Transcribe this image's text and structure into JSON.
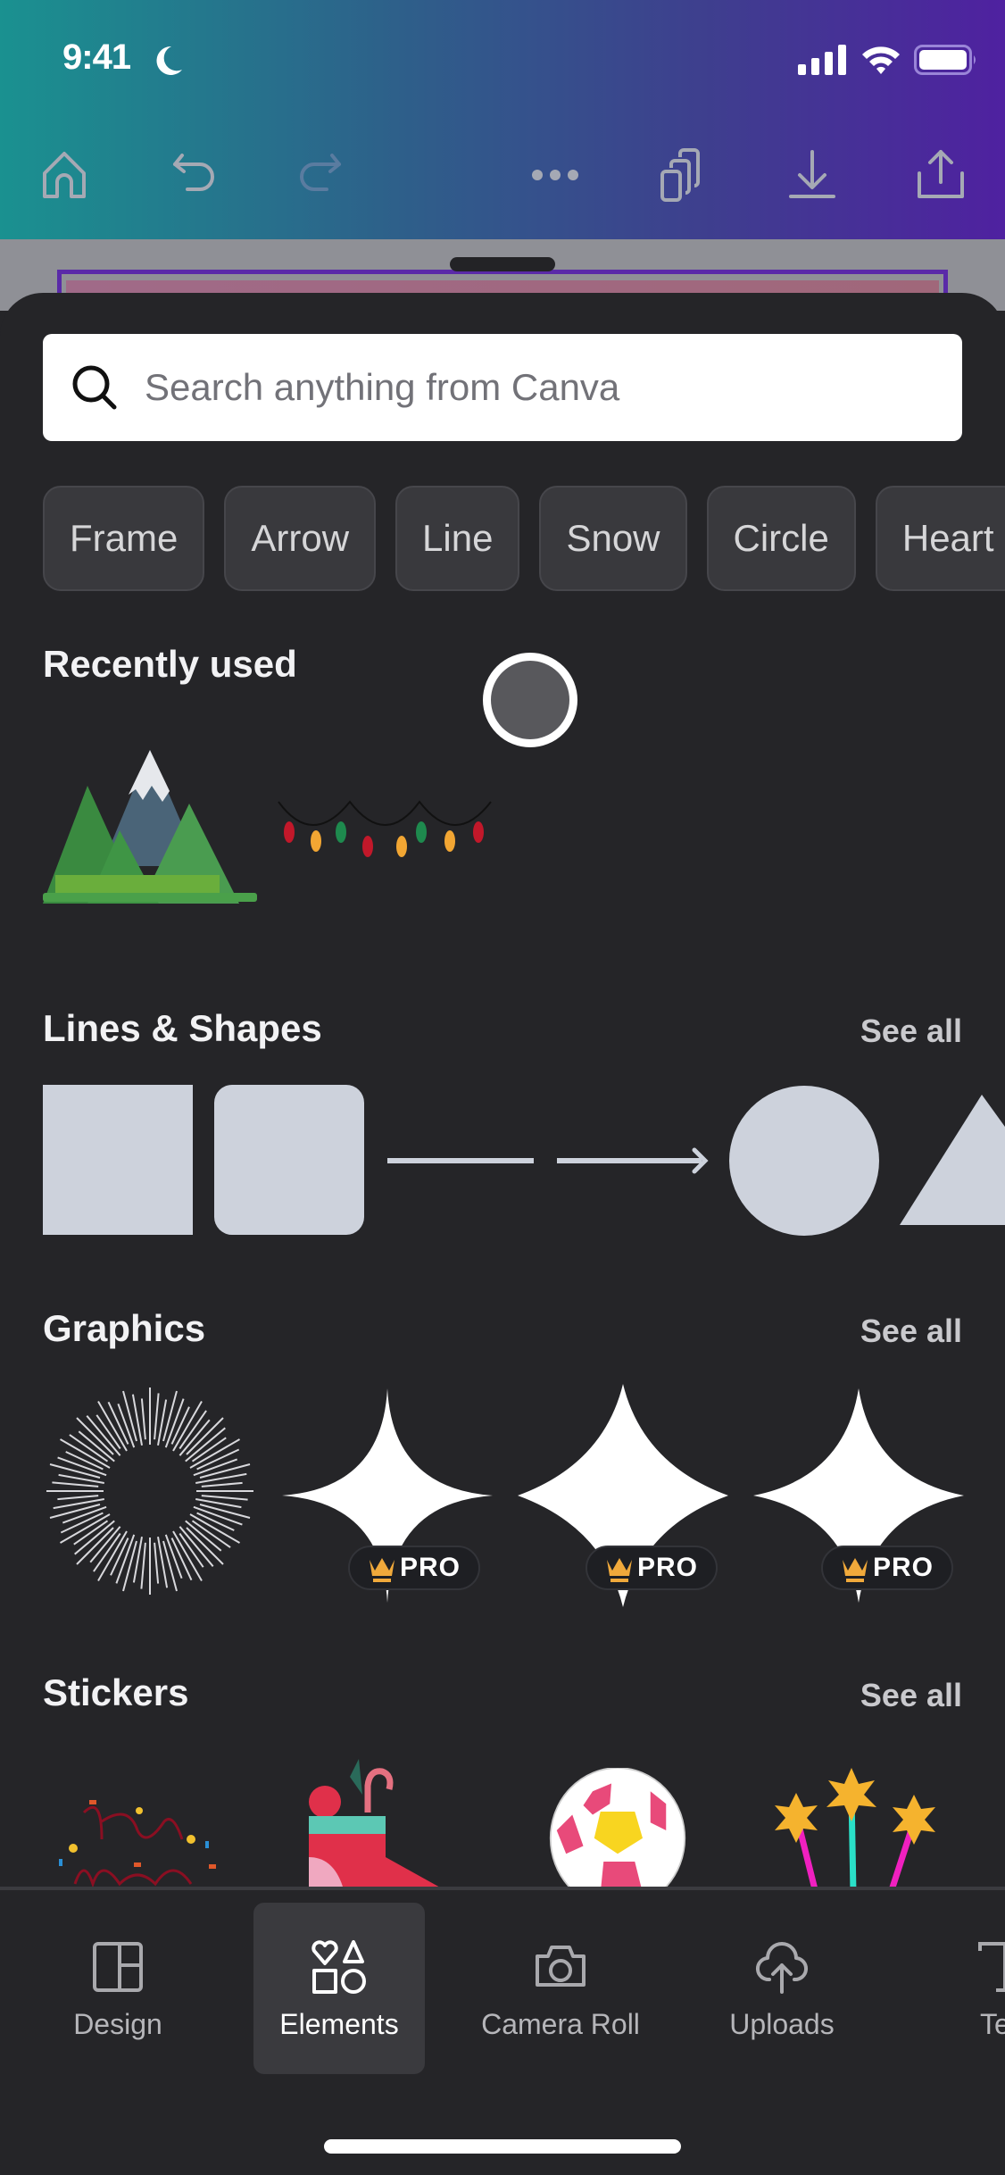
{
  "status_bar": {
    "time": "9:41",
    "focus_icon": "moon-icon",
    "signal_icon": "cellular-signal-icon",
    "wifi_icon": "wifi-icon",
    "battery_icon": "battery-icon"
  },
  "toolbar": {
    "buttons": [
      {
        "name": "home",
        "icon": "home-icon"
      },
      {
        "name": "undo",
        "icon": "undo-icon"
      },
      {
        "name": "redo",
        "icon": "redo-icon",
        "disabled": true
      },
      {
        "name": "more",
        "icon": "more-dots-icon"
      },
      {
        "name": "pages",
        "icon": "pages-icon"
      },
      {
        "name": "download",
        "icon": "download-icon"
      },
      {
        "name": "share",
        "icon": "share-icon"
      }
    ]
  },
  "colors": {
    "header_start": "#1a9190",
    "header_end": "#4f21a0",
    "sheet_bg": "#252528",
    "shape_fill": "#cdd2dc",
    "pro_crown": "#f0a93b"
  },
  "search": {
    "placeholder": "Search anything from Canva"
  },
  "chips": [
    "Frame",
    "Arrow",
    "Line",
    "Snow",
    "Circle",
    "Heart"
  ],
  "sections": {
    "recently_used": {
      "title": "Recently used",
      "items": [
        "mountains-graphic",
        "christmas-lights-graphic"
      ]
    },
    "lines_shapes": {
      "title": "Lines & Shapes",
      "see_all": "See all",
      "items": [
        "square",
        "rounded-square",
        "line",
        "arrow-line",
        "circle",
        "triangle"
      ]
    },
    "graphics": {
      "title": "Graphics",
      "see_all": "See all",
      "items": [
        {
          "name": "sunburst-lines",
          "pro": false
        },
        {
          "name": "sparkle-thin",
          "pro": true
        },
        {
          "name": "sparkle-medium",
          "pro": true
        },
        {
          "name": "sparkle-wide",
          "pro": true
        }
      ],
      "pro_label": "PRO"
    },
    "stickers": {
      "title": "Stickers",
      "see_all": "See all",
      "items": [
        "happy-new-year",
        "christmas-stocking",
        "soccer-ball",
        "sparklers"
      ]
    }
  },
  "bottom_nav": {
    "active": "Elements",
    "tabs": [
      {
        "label": "Design",
        "icon": "design-layout-icon"
      },
      {
        "label": "Elements",
        "icon": "elements-shapes-icon"
      },
      {
        "label": "Camera Roll",
        "icon": "camera-icon"
      },
      {
        "label": "Uploads",
        "icon": "cloud-upload-icon"
      },
      {
        "label": "Te",
        "icon": "text-icon"
      }
    ]
  }
}
